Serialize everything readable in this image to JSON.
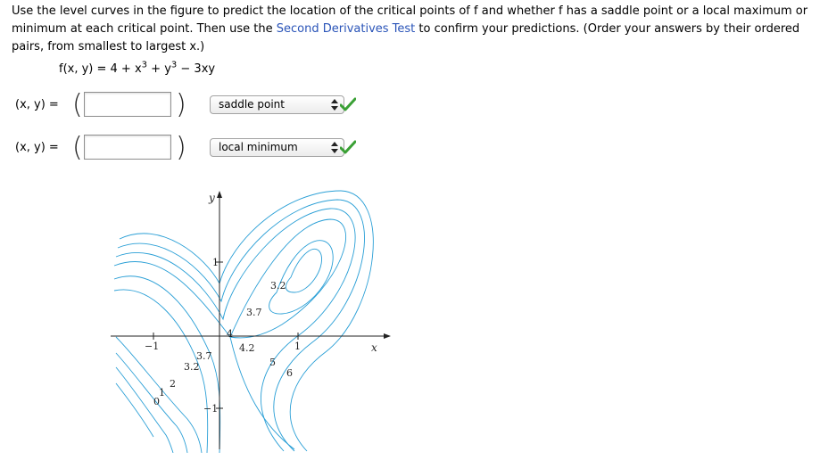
{
  "prompt": {
    "text_before_link": "Use the level curves in the figure to predict the location of the critical points of f and whether f has a saddle point or a local maximum or minimum at each critical point. Then use the ",
    "link_text": "Second Derivatives Test",
    "text_after_link": " to confirm your predictions. (Order your answers by their ordered pairs, from smallest to largest x.)"
  },
  "formula": {
    "lhs": "f(x, y) = 4 + x",
    "exp1": "3",
    "mid": " + y",
    "exp2": "3",
    "rest": " − 3xy"
  },
  "answers": [
    {
      "label": "(x, y) =",
      "open_paren": "(",
      "close_paren": ")",
      "value": "",
      "type_selected": "saddle point",
      "status": "correct"
    },
    {
      "label": "(x, y) =",
      "open_paren": "(",
      "close_paren": ")",
      "value": "",
      "type_selected": "local minimum",
      "status": "correct"
    }
  ],
  "figure": {
    "x_axis_name": "x",
    "y_axis_name": "y",
    "tick_labels": {
      "x_neg": "−1",
      "x_pos": "1",
      "y_pos": "1",
      "y_neg": "−1"
    },
    "contour_labels": [
      "0",
      "1",
      "2",
      "3.2",
      "3.7",
      "3.7",
      "3.2",
      "4",
      "4.2",
      "5",
      "6"
    ],
    "curve_color": "#2a9fd6"
  },
  "colors": {
    "check": "#3aa035",
    "link": "#2a54b8"
  }
}
